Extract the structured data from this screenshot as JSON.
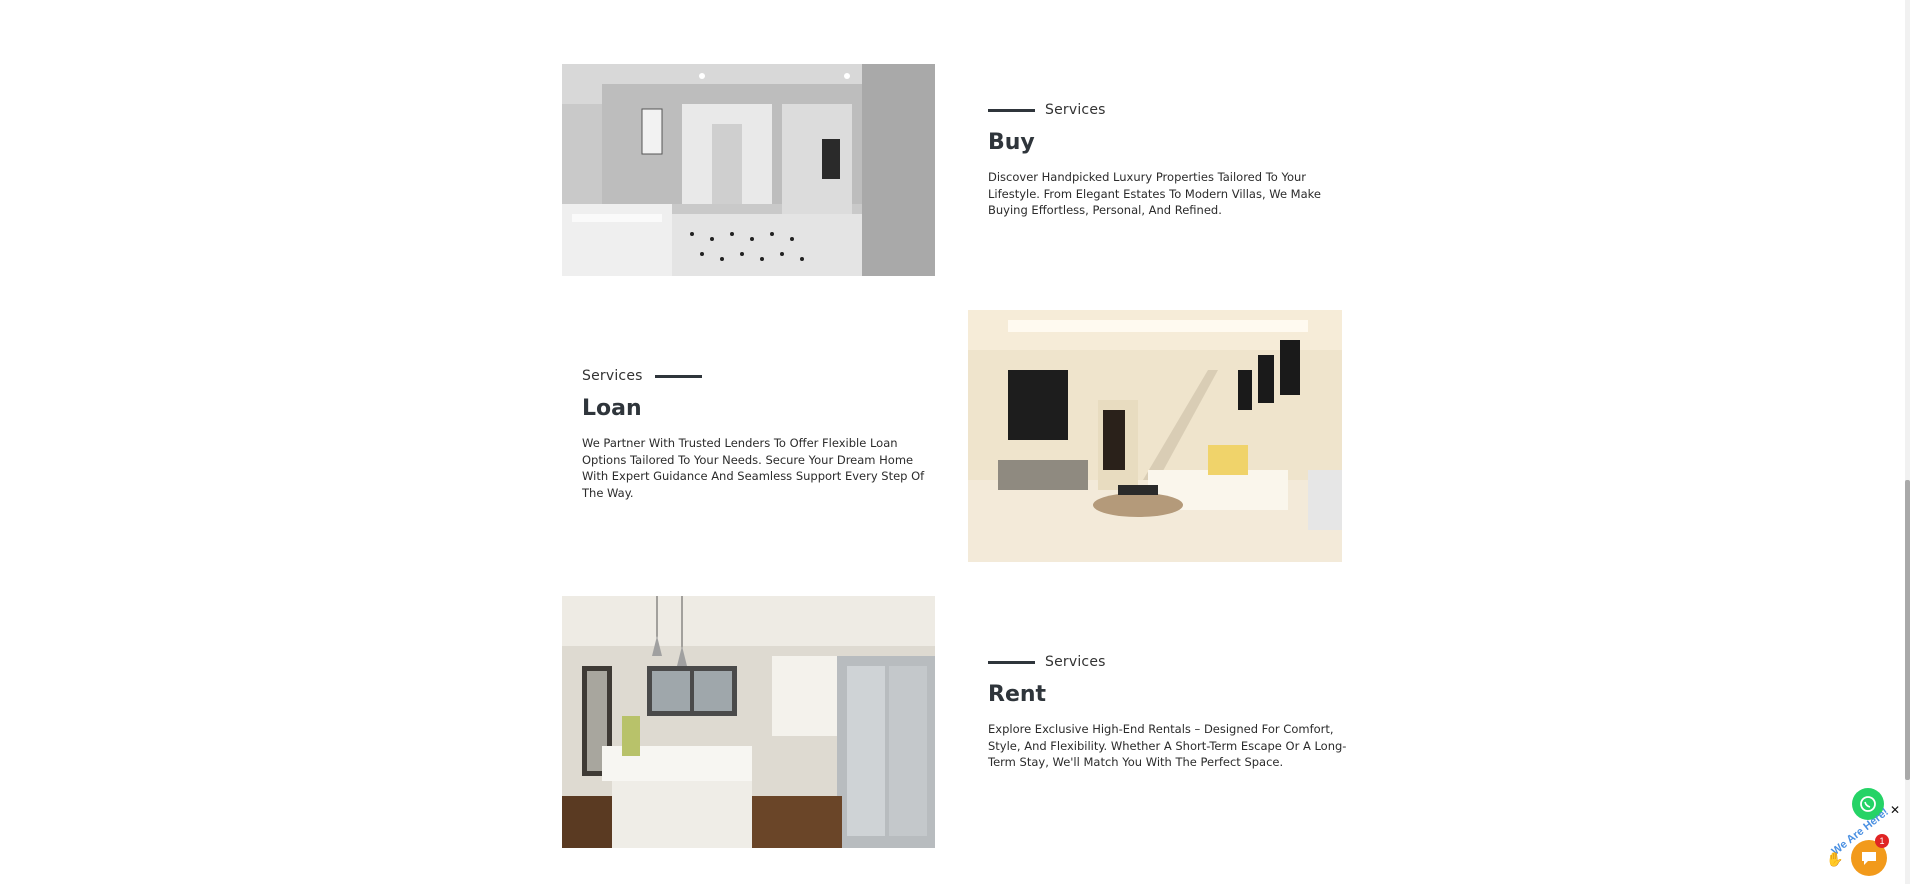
{
  "services": [
    {
      "eyebrow": "Services",
      "title": "Buy",
      "description": "Discover Handpicked Luxury Properties Tailored To Your Lifestyle. From Elegant Estates To Modern Villas, We Make Buying Effortless, Personal, And Refined.",
      "image": "bathroom-image"
    },
    {
      "eyebrow": "Services",
      "title": "Loan",
      "description": "We Partner With Trusted Lenders To Offer Flexible Loan Options Tailored To Your Needs. Secure Your Dream Home With Expert Guidance And Seamless Support Every Step Of The Way.",
      "image": "living-room-image"
    },
    {
      "eyebrow": "Services",
      "title": "Rent",
      "description": "Explore Exclusive High-End Rentals – Designed For Comfort, Style, And Flexibility. Whether A Short-Term Escape Or A Long-Term Stay, We'll Match You With The Perfect Space.",
      "image": "kitchen-image"
    }
  ],
  "widgets": {
    "whatsapp_icon": "whatsapp-icon",
    "close_label": "✕",
    "chat_icon": "chat-bubble-icon",
    "chat_badge": "1",
    "we_are_here": "We Are Here!",
    "accent": "#25d366",
    "chat_color": "#f29a1b"
  }
}
